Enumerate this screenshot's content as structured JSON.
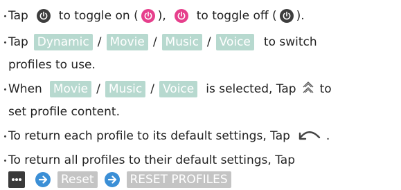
{
  "bullets": {
    "b1": {
      "bullet": "・",
      "t1": "Tap",
      "t2": "to toggle on (",
      "t3": "),",
      "t4": "to toggle off (",
      "t5": ")."
    },
    "b2": {
      "bullet": "・",
      "t1": "Tap",
      "chips": [
        "Dynamic",
        "Movie",
        "Music",
        "Voice"
      ],
      "slash": "/",
      "t2": "to switch",
      "cont": "profiles to use."
    },
    "b3": {
      "bullet": "・",
      "t1": "When",
      "chips": [
        "Movie",
        "Music",
        "Voice"
      ],
      "slash": "/",
      "t2": "is selected, Tap",
      "t3": "to",
      "cont": "set profile content."
    },
    "b4": {
      "bullet": "・",
      "t1": "To return each profile to its default settings, Tap",
      "t2": "."
    },
    "b5": {
      "bullet": "・",
      "t1": "To return all profiles to their default settings, Tap",
      "chip_reset": "Reset",
      "chip_reset_profiles": "RESET PROFILES"
    }
  },
  "icons": {
    "power_off": "power-icon-dark",
    "power_on": "power-icon-pink",
    "expand": "double-chevron-up-icon",
    "reset": "reset-curve-icon",
    "menu": "more-dots-icon",
    "arrow": "arrow-right-icon"
  },
  "colors": {
    "power_off": "#3d3d3d",
    "power_on": "#e63f8c",
    "profile_chip": "#b7d9cf",
    "menu_chip": "#c4c4c4",
    "arrow": "#3b8fd6"
  }
}
